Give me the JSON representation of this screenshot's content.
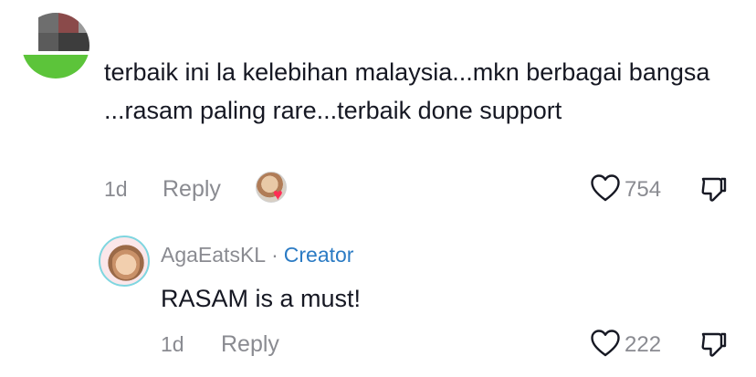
{
  "top_comment": {
    "text": "terbaik ini la kelebihan malaysia...mkn berbagai bangsa ...rasam paling rare...terbaik done support",
    "date": "1d",
    "reply_label": "Reply",
    "like_count": "754",
    "creator_liked_icon": "creator-liked-heart-icon"
  },
  "reply": {
    "author": "AgaEatsKL",
    "separator": "·",
    "badge": "Creator",
    "text": "RASAM is a must!",
    "date": "1d",
    "reply_label": "Reply",
    "like_count": "222"
  },
  "colors": {
    "text_primary": "#161823",
    "text_secondary": "#8a8b91",
    "creator_badge": "#2b7bc4",
    "like_heart": "#fe2c55"
  }
}
